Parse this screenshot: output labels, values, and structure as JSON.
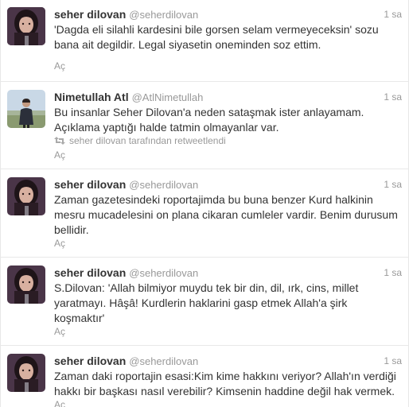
{
  "tweets": [
    {
      "fullname": "seher dilovan",
      "username": "@seherdilovan",
      "time": "1 sa",
      "text": "'Dagda eli silahli kardesini bile gorsen selam vermeyeceksin' sozu\nbana ait degildir. Legal siyasetin oneminden soz ettim.",
      "open_label": "Aç",
      "avatar": "woman-portrait"
    },
    {
      "fullname": "Nimetullah Atl",
      "username": "@AtlNimetullah",
      "time": "1 sa",
      "text": "Bu insanlar Seher Dilovan'a neden sataşmak ister anlayamam.\nAçıklama yaptığı halde tatmin olmayanlar var.",
      "retweet_text": "seher dilovan tarafından retweetlendi",
      "open_label": "Aç",
      "avatar": "man-outdoor"
    },
    {
      "fullname": "seher dilovan",
      "username": "@seherdilovan",
      "time": "1 sa",
      "text": "Zaman gazetesindeki roportajimda bu buna benzer Kurd halkinin\nmesru mucadelesini on plana cikaran cumleler vardir. Benim durusum\nbellidir.",
      "open_label": "Aç",
      "avatar": "woman-portrait"
    },
    {
      "fullname": "seher dilovan",
      "username": "@seherdilovan",
      "time": "1 sa",
      "text": "S.Dilovan: 'Allah bilmiyor muydu tek bir din, dil, ırk, cins, millet\nyaratmayı. Hâşâ! Kurdlerin haklarini gasp etmek Allah'a şirk\nkoşmaktır'",
      "open_label": "Aç",
      "avatar": "woman-portrait"
    },
    {
      "fullname": "seher dilovan",
      "username": "@seherdilovan",
      "time": "1 sa",
      "text": "Zaman daki roportajin esasi:Kim kime hakkını veriyor? Allah'ın verdiği\nhakkı bir başkası nasıl verebilir? Kimsenin haddine değil hak vermek.",
      "open_label": "Aç",
      "avatar": "woman-portrait"
    }
  ],
  "colors": {
    "name": "#333333",
    "muted": "#999999",
    "border": "#e8e8e8"
  }
}
